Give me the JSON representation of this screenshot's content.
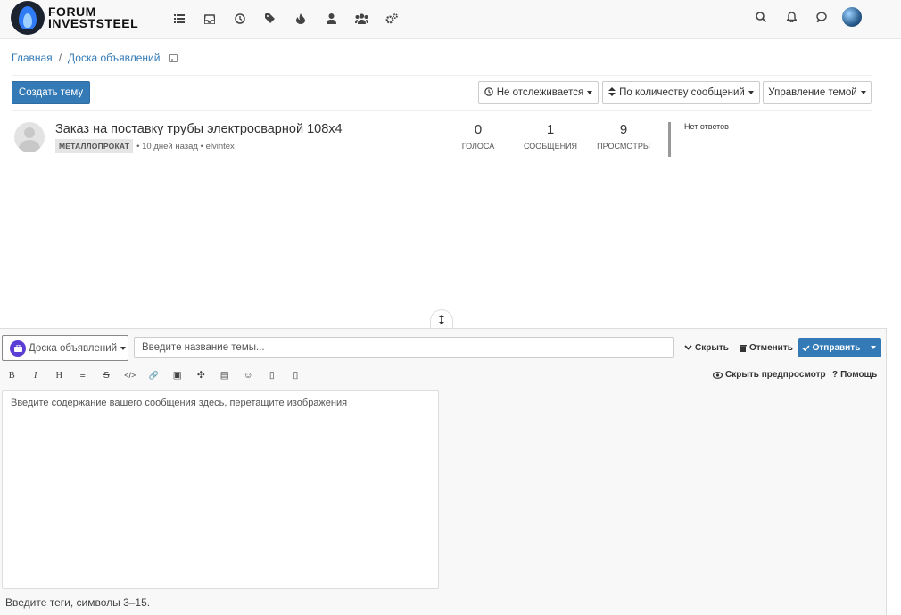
{
  "brand": {
    "line1": "FORUM",
    "line2": "INVESTSTEEL"
  },
  "nav": {
    "left_icons": [
      "list-icon",
      "inbox-icon",
      "clock-icon",
      "tags-icon",
      "fire-icon",
      "user-icon",
      "users-icon",
      "cogs-icon"
    ],
    "right_icons": [
      "search-icon",
      "bell-icon",
      "chat-icon"
    ]
  },
  "breadcrumb": {
    "home": "Главная",
    "sep": "/",
    "current": "Доска объявлений"
  },
  "toolbar": {
    "create": "Создать тему",
    "watch": "Не отслеживается",
    "sort": "По количеству сообщений",
    "manage": "Управление темой"
  },
  "topic": {
    "title": "Заказ на поставку трубы электросварной 108х4",
    "tag": "МЕТАЛЛОПРОКАТ",
    "meta": "• 10 дней назад • elvintex",
    "votes": {
      "num": "0",
      "label": "ГОЛОСА"
    },
    "posts": {
      "num": "1",
      "label": "СООБЩЕНИЯ"
    },
    "views": {
      "num": "9",
      "label": "ПРОСМОТРЫ"
    },
    "replies": "Нет ответов"
  },
  "composer": {
    "category": "Доска объявлений",
    "title_placeholder": "Введите название темы...",
    "hide": "Скрыть",
    "discard": "Отменить",
    "submit": "Отправить",
    "hide_preview": "Скрыть предпросмотр",
    "help": "Помощь",
    "body_placeholder": "Введите содержание вашего сообщения здесь, перетащите изображения",
    "tags_placeholder": "Введите теги, символы 3–15.",
    "format_buttons": [
      "B",
      "I",
      "H",
      "≡",
      "S",
      "</>",
      "🔗",
      "▣",
      "✣",
      "▤",
      "☺",
      "▯",
      "▯"
    ]
  },
  "colors": {
    "primary": "#337ab7",
    "category_badge": "#5b3ed6"
  }
}
